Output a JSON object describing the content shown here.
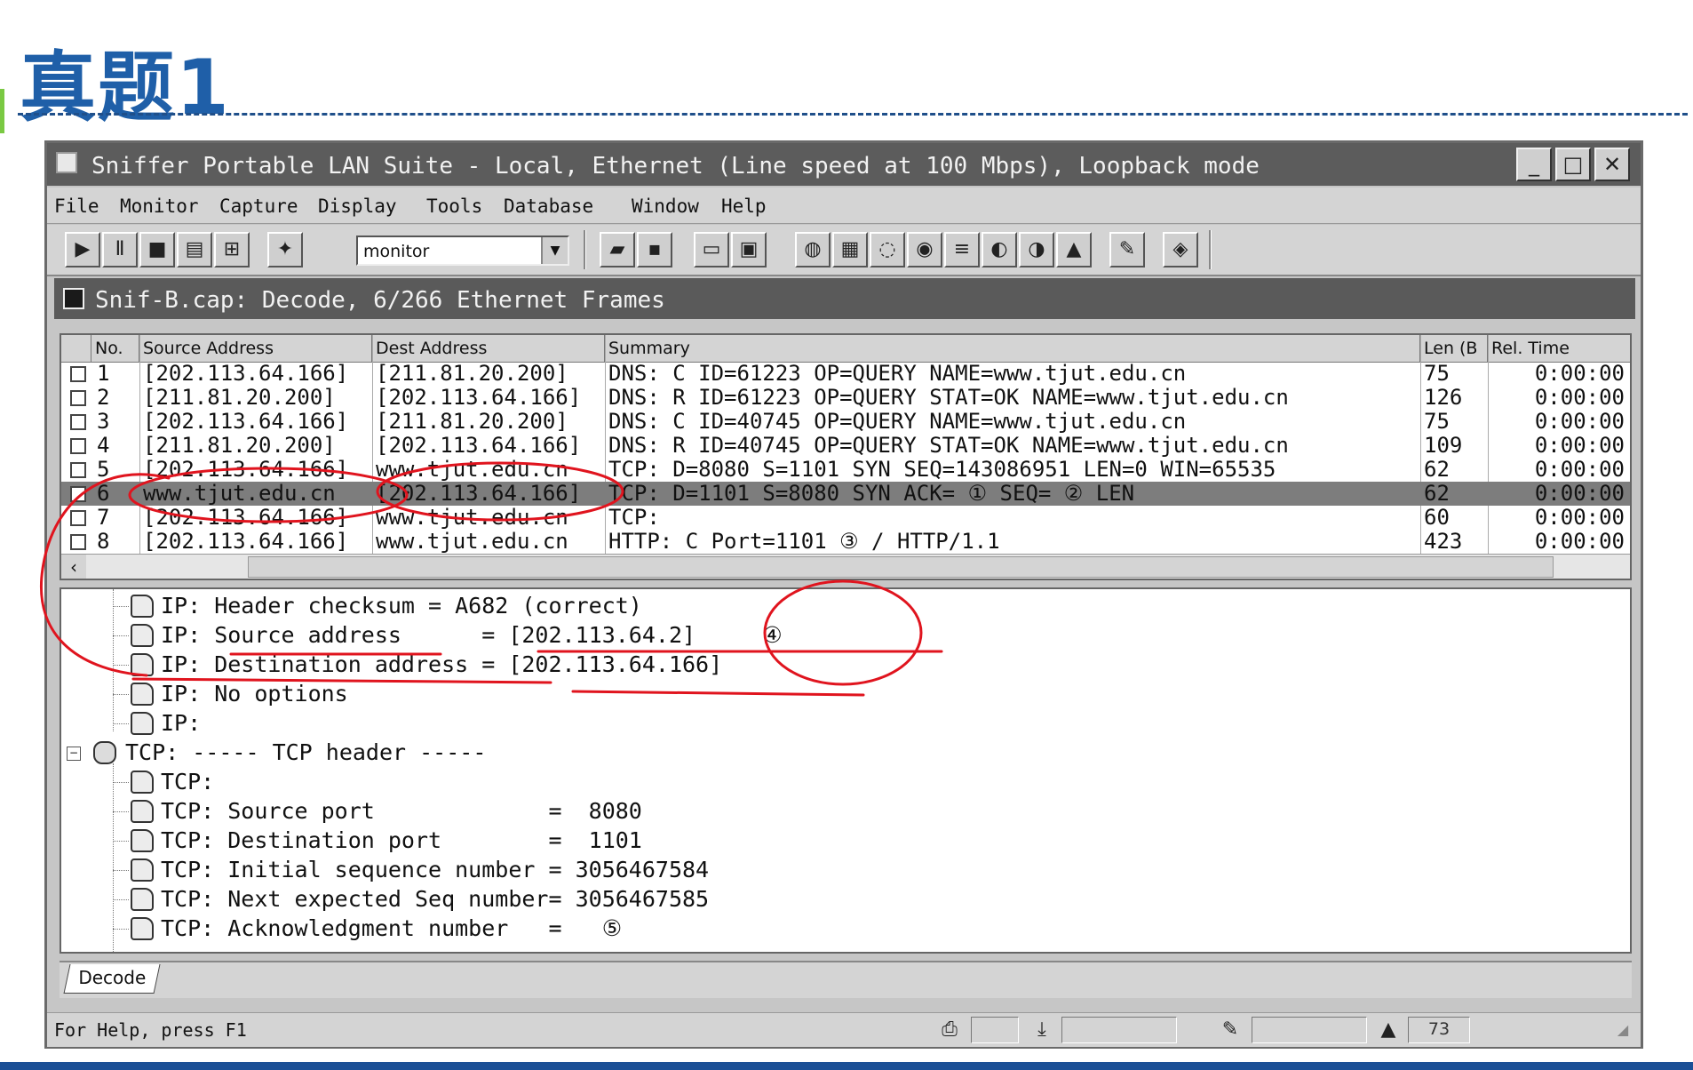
{
  "slide": {
    "title": "真题1"
  },
  "window": {
    "title": "Sniffer Portable LAN Suite - Local, Ethernet (Line speed at 100 Mbps), Loopback mode",
    "controls": {
      "minimize": "_",
      "maximize": "□",
      "close": "✕"
    }
  },
  "menu": [
    "File",
    "Monitor",
    "Capture",
    "Display",
    "Tools",
    "Database",
    "Window",
    "Help"
  ],
  "toolbar": {
    "monitor_select_value": "monitor"
  },
  "capture_window": {
    "title": "Snif-B.cap: Decode, 6/266 Ethernet Frames"
  },
  "packets": {
    "columns": [
      "No.",
      "Source Address",
      "Dest Address",
      "Summary",
      "Len (B",
      "Rel. Time"
    ],
    "rows": [
      {
        "no": "1",
        "src": "[202.113.64.166]",
        "dst": "[211.81.20.200]",
        "summary": "DNS: C ID=61223 OP=QUERY NAME=www.tjut.edu.cn",
        "len": "75",
        "time": "0:00:00"
      },
      {
        "no": "2",
        "src": "[211.81.20.200]",
        "dst": "[202.113.64.166]",
        "summary": "DNS: R ID=61223 OP=QUERY STAT=OK NAME=www.tjut.edu.cn",
        "len": "126",
        "time": "0:00:00"
      },
      {
        "no": "3",
        "src": "[202.113.64.166]",
        "dst": "[211.81.20.200]",
        "summary": "DNS: C ID=40745 OP=QUERY NAME=www.tjut.edu.cn",
        "len": "75",
        "time": "0:00:00"
      },
      {
        "no": "4",
        "src": "[211.81.20.200]",
        "dst": "[202.113.64.166]",
        "summary": "DNS: R ID=40745 OP=QUERY STAT=OK NAME=www.tjut.edu.cn",
        "len": "109",
        "time": "0:00:00"
      },
      {
        "no": "5",
        "src": "[202.113.64.166]",
        "dst": "www.tjut.edu.cn",
        "summary": "TCP: D=8080 S=1101 SYN SEQ=143086951 LEN=0 WIN=65535",
        "len": "62",
        "time": "0:00:00"
      },
      {
        "no": "6",
        "src": "www.tjut.edu.cn",
        "dst": "[202.113.64.166]",
        "summary": "TCP: D=1101 S=8080 SYN ACK=   ①     SEQ=   ②          LEN",
        "len": "62",
        "time": "0:00:00",
        "selected": true
      },
      {
        "no": "7",
        "src": "[202.113.64.166]",
        "dst": "www.tjut.edu.cn",
        "summary": "TCP:",
        "len": "60",
        "time": "0:00:00"
      },
      {
        "no": "8",
        "src": "[202.113.64.166]",
        "dst": "www.tjut.edu.cn",
        "summary": "HTTP: C Port=1101   ③   / HTTP/1.1",
        "len": "423",
        "time": "0:00:00"
      }
    ]
  },
  "detail": {
    "lines": [
      {
        "text": "IP: Header checksum = A682 (correct)",
        "indent": 1
      },
      {
        "text": "IP: Source address      = [202.113.64.2]     ④",
        "indent": 1
      },
      {
        "text": "IP: Destination address = [202.113.64.166]",
        "indent": 1
      },
      {
        "text": "IP: No options",
        "indent": 1
      },
      {
        "text": "IP:",
        "indent": 1
      },
      {
        "text": "TCP: ----- TCP header -----",
        "indent": 0
      },
      {
        "text": "TCP:",
        "indent": 1
      },
      {
        "text": "TCP: Source port             =  8080",
        "indent": 1
      },
      {
        "text": "TCP: Destination port        =  1101",
        "indent": 1
      },
      {
        "text": "TCP: Initial sequence number = 3056467584",
        "indent": 1
      },
      {
        "text": "TCP: Next expected Seq number= 3056467585",
        "indent": 1
      },
      {
        "text": "TCP: Acknowledgment number   =   ⑤",
        "indent": 1
      }
    ]
  },
  "tabs": {
    "decode": "Decode"
  },
  "status": {
    "help": "For Help, press F1",
    "count": "73"
  },
  "colors": {
    "title_blue": "#1f5fa8",
    "selected_row": "#7d7d7d",
    "ink_red": "#e0141e"
  }
}
